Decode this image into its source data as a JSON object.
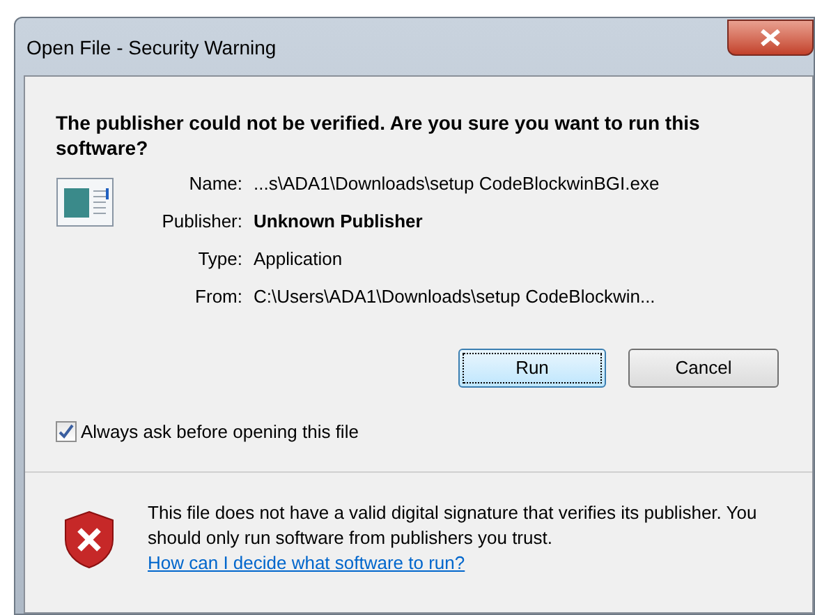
{
  "window": {
    "title": "Open File - Security Warning"
  },
  "heading": "The publisher could not be verified.  Are you sure you want to run this software?",
  "details": [
    {
      "label": "Name:",
      "value": "...s\\ADA1\\Downloads\\setup CodeBlockwinBGI.exe",
      "bold": false
    },
    {
      "label": "Publisher:",
      "value": "Unknown Publisher",
      "bold": true
    },
    {
      "label": "Type:",
      "value": "Application",
      "bold": false
    },
    {
      "label": "From:",
      "value": "C:\\Users\\ADA1\\Downloads\\setup CodeBlockwin...",
      "bold": false
    }
  ],
  "buttons": [
    {
      "label": "Run",
      "default": true
    },
    {
      "label": "Cancel",
      "default": false
    }
  ],
  "checkbox": {
    "label": "Always ask before opening this file",
    "checked": true
  },
  "warning": {
    "text": "This file does not have a valid digital signature that verifies its publisher.  You should only run software from publishers you trust.",
    "link": "How can I decide what software to run?"
  }
}
